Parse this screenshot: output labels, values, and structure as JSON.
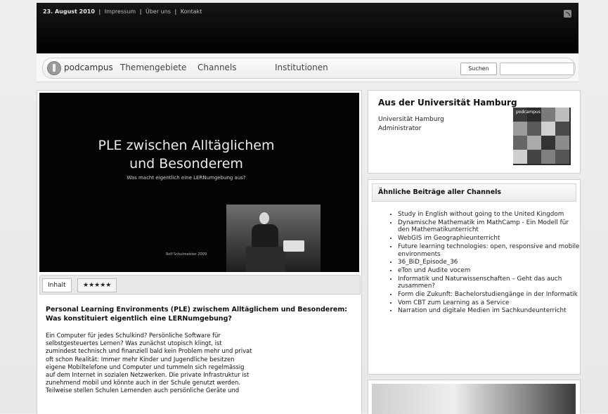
{
  "topbar": {
    "date": "23. August 2010",
    "links": [
      "Impressum",
      "Über uns",
      "Kontakt"
    ]
  },
  "nav": {
    "logo_text": "podcampus",
    "items": [
      "Themengebiete",
      "Channels",
      "Institutionen"
    ],
    "search_button": "Suchen",
    "search_value": ""
  },
  "video": {
    "title_line1": "PLE zwischen Alltäglichem",
    "title_line2": "und Besonderem",
    "subtitle": "Was macht eigentlich eine LERNumgebung aus?",
    "credit": "Rolf Schulmeister 2009"
  },
  "tabs": {
    "content": "Inhalt",
    "rating": "★★★★★"
  },
  "article": {
    "title": "Personal Learning Environments (PLE) zwischem Alltäglichem und Besonderem: Was konstituiert eigentlich eine LERNumgebung?",
    "body": "Ein Computer für jedes Schulkind? Persönliche Software für\nselbstgesteuertes Lernen? Was zunächst utopisch klingt, ist\nzumindest technisch und finanziell bald kein Problem mehr und privat\noft schon Realität: Immer mehr Kinder und Jugendliche besitzen\neigene Mobiltelefone und Computer und tummeln sich regelmässig\nauf dem Internet in sozialen Netzwerken. Die private Infrastruktur ist\nzunehmend mobil und könnte auch in der Schule genutzt werden.\nTeilweise stellen Schulen Lernenden auch persönliche Geräte und"
  },
  "sidebar_uni": {
    "title": "Aus der Universität Hamburg",
    "line1": "Universität Hamburg",
    "line2": "Administrator",
    "thumb_logo": "podcampus"
  },
  "sidebar_related": {
    "title": "Ähnliche Beiträge aller Channels",
    "items": [
      "Study in English without going to the United Kingdom",
      "Dynamische Mathematik im MathCamp - Ein Modell für den Mathematikunterricht",
      "WebGIS im Geographieunterricht",
      "Future learning technologies: open, responsive and mobile environments",
      "36_BiD_Episode_36",
      "eTon und Audite vocem",
      "Informatik und Naturwissenschaften – Geht das auch zusammen?",
      "Form die Zukunft: Bachelorstudiengänge in der Informatik",
      "Vom CBT zum Learning as a Service",
      "Narration und digitale Medien im Sachkundeunterricht"
    ]
  }
}
